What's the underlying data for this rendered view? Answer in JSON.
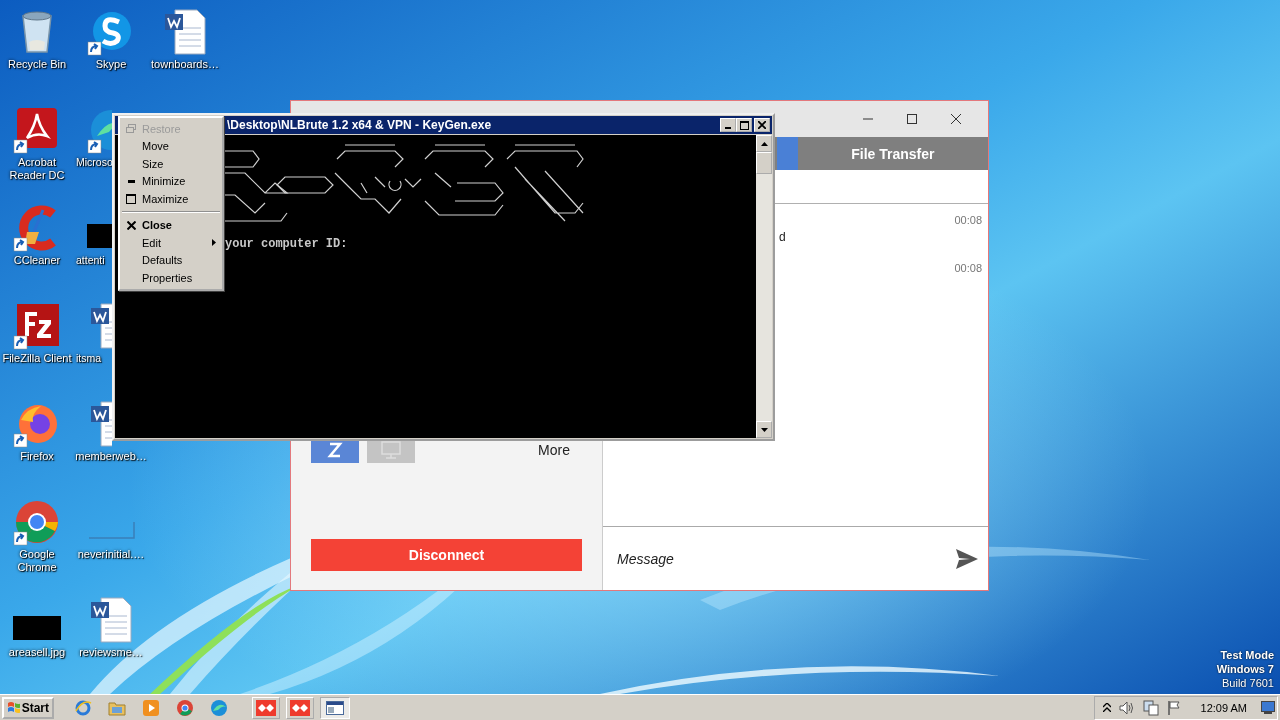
{
  "desktop": {
    "icons": [
      {
        "label": "Recycle Bin",
        "kind": "trash",
        "shortcut": false
      },
      {
        "label": "Acrobat Reader DC",
        "kind": "acrobat",
        "shortcut": true
      },
      {
        "label": "CCleaner",
        "kind": "ccleaner",
        "shortcut": true
      },
      {
        "label": "FileZilla Client",
        "kind": "filezilla",
        "shortcut": true
      },
      {
        "label": "Firefox",
        "kind": "firefox",
        "shortcut": true
      },
      {
        "label": "Google Chrome",
        "kind": "chrome",
        "shortcut": true
      },
      {
        "label": "areasell.jpg",
        "kind": "dark-image",
        "shortcut": false
      },
      {
        "label": "Skype",
        "kind": "skype",
        "shortcut": true
      },
      {
        "label": "Microso",
        "kind": "edge",
        "shortcut": true
      },
      {
        "label": "attenti",
        "kind": "dark-image",
        "shortcut": false
      },
      {
        "label": "itsma",
        "kind": "word",
        "shortcut": false
      },
      {
        "label": "memberweb…",
        "kind": "word",
        "shortcut": false
      },
      {
        "label": "neverinitial.…",
        "kind": "blank-image",
        "shortcut": false
      },
      {
        "label": "reviewsme…",
        "kind": "word",
        "shortcut": false
      },
      {
        "label": "townboards…",
        "kind": "word",
        "shortcut": false
      }
    ],
    "os_notice": [
      "Test Mode",
      "Windows 7",
      "Build 7601"
    ]
  },
  "chat_window": {
    "tabs": [
      {
        "selected": true
      },
      {
        "label": "File Transfer",
        "selected": false
      }
    ],
    "messages": [
      {
        "time": "00:08",
        "text": "d"
      },
      {
        "time": "00:08"
      }
    ],
    "more_label": "More",
    "disconnect_button": "Disconnect",
    "message_field": {
      "placeholder": "Message"
    }
  },
  "console_window": {
    "title": "\\Desktop\\NLBrute 1.2 x64 & VPN - KeyGen.exe",
    "output": "your computer ID:"
  },
  "context_menu": {
    "items": [
      {
        "label": "Restore",
        "kind": "restore",
        "disabled": true
      },
      {
        "label": "Move",
        "kind": "plain",
        "disabled": false
      },
      {
        "label": "Size",
        "kind": "plain",
        "disabled": false
      },
      {
        "label": "Minimize",
        "kind": "minimize",
        "disabled": false
      },
      {
        "label": "Maximize",
        "kind": "maximize",
        "disabled": false
      },
      {
        "kind": "separator"
      },
      {
        "label": "Close",
        "kind": "close",
        "disabled": false
      },
      {
        "label": "Edit",
        "kind": "submenu",
        "disabled": false
      },
      {
        "label": "Defaults",
        "kind": "plain",
        "disabled": false
      },
      {
        "label": "Properties",
        "kind": "plain",
        "disabled": false
      }
    ]
  },
  "taskbar": {
    "start_label": "Start",
    "quick_launch": [
      {
        "kind": "ie"
      },
      {
        "kind": "folder"
      },
      {
        "kind": "media"
      },
      {
        "kind": "chrome"
      },
      {
        "kind": "edge"
      }
    ],
    "windows": [
      {
        "kind": "app",
        "selected": false
      },
      {
        "kind": "app",
        "selected": false
      },
      {
        "kind": "console",
        "selected": true
      }
    ],
    "clock": "12:09 AM"
  }
}
